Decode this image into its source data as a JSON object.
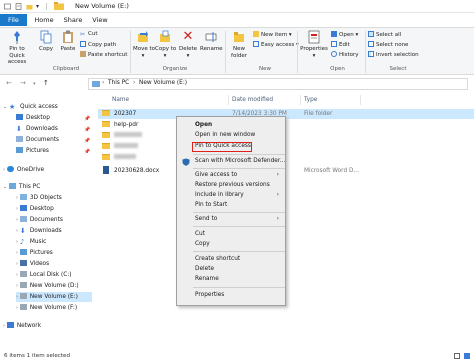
{
  "window": {
    "title": "New Volume (E:)"
  },
  "tabs": [
    {
      "label": "File"
    },
    {
      "label": "Home"
    },
    {
      "label": "Share"
    },
    {
      "label": "View"
    }
  ],
  "ribbon": {
    "pin_label": "Pin to Quick access",
    "copy_label": "Copy",
    "paste_label": "Paste",
    "cut_label": "Cut",
    "copy_path_label": "Copy path",
    "paste_shortcut_label": "Paste shortcut",
    "move_to_label": "Move to",
    "copy_to_label": "Copy to",
    "delete_label": "Delete",
    "rename_label": "Rename",
    "new_folder_label": "New folder",
    "new_item_label": "New item",
    "easy_access_label": "Easy access",
    "properties_label": "Properties",
    "open_label": "Open",
    "edit_label": "Edit",
    "history_label": "History",
    "select_all_label": "Select all",
    "select_none_label": "Select none",
    "invert_selection_label": "Invert selection",
    "groups": {
      "clipboard": "Clipboard",
      "organize": "Organize",
      "new": "New",
      "open": "Open",
      "select": "Select"
    }
  },
  "address": {
    "this_pc": "This PC",
    "volume": "New Volume (E:)"
  },
  "nav": {
    "quick_access": "Quick access",
    "desktop": "Desktop",
    "downloads": "Downloads",
    "documents": "Documents",
    "pictures": "Pictures",
    "onedrive": "OneDrive",
    "this_pc": "This PC",
    "objects_3d": "3D Objects",
    "desktop2": "Desktop",
    "documents2": "Documents",
    "downloads2": "Downloads",
    "music": "Music",
    "pictures2": "Pictures",
    "videos": "Videos",
    "local_disk": "Local Disk (C:)",
    "vol_d": "New Volume (D:)",
    "vol_e": "New Volume (E:)",
    "vol_f": "New Volume (F:)",
    "network": "Network"
  },
  "columns": {
    "name": "Name",
    "date": "Date modified",
    "type": "Type"
  },
  "files": [
    {
      "name": "202307",
      "date": "7/14/2023 3:30 PM",
      "type": "File folder"
    },
    {
      "name": "help-pdr",
      "date": "",
      "type": ""
    },
    {
      "name": "",
      "date": "",
      "type": ""
    },
    {
      "name": "",
      "date": "",
      "type": ""
    },
    {
      "name": "",
      "date": "",
      "type": ""
    },
    {
      "name": "20230628.docx",
      "date": "",
      "type": "Microsoft Word D..."
    }
  ],
  "context_menu": {
    "open": "Open",
    "open_new_window": "Open in new window",
    "pin_quick_access": "Pin to Quick access",
    "scan_defender": "Scan with Microsoft Defender...",
    "give_access": "Give access to",
    "restore_versions": "Restore previous versions",
    "include_library": "Include in library",
    "pin_start": "Pin to Start",
    "send_to": "Send to",
    "cut": "Cut",
    "copy": "Copy",
    "create_shortcut": "Create shortcut",
    "delete": "Delete",
    "rename": "Rename",
    "properties": "Properties"
  },
  "status": {
    "text": "6 items    1 item selected"
  },
  "colors": {
    "accent": "#1979ca",
    "selection": "#cce8ff",
    "highlight_border": "#e0201b",
    "folder": "#f4c542"
  }
}
